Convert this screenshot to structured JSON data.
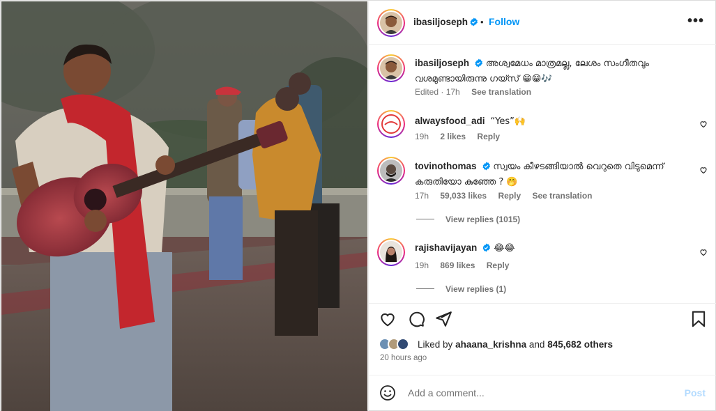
{
  "post": {
    "author": "ibasiljoseph",
    "follow_label": "Follow",
    "more_label": "•••",
    "separator": "•"
  },
  "caption": {
    "username": "ibasiljoseph",
    "text": "അശ്വമേധം മാത്രമല്ല, ലേശം സംഗീതവും വശമുണ്ടായിരുന്നു ഗയ്സ് 😁😁🎶",
    "edited": "Edited · 17h",
    "see_translation": "See translation"
  },
  "comments": [
    {
      "username": "alwaysfood_adi",
      "text": "“Yes”🙌",
      "time": "19h",
      "likes": "2 likes",
      "reply": "Reply"
    },
    {
      "username": "tovinothomas",
      "text": "സ്വയം കീഴടങ്ങിയാൽ വെറുതെ വിടുമെന്ന് കരുതിയോ കുഞ്ഞേ ? 🤭",
      "time": "17h",
      "likes": "59,033 likes",
      "reply": "Reply",
      "see_translation": "See translation",
      "view_replies": "View replies (1015)"
    },
    {
      "username": "rajishavijayan",
      "text": "😂😂",
      "time": "19h",
      "likes": "869 likes",
      "reply": "Reply",
      "view_replies": "View replies (1)"
    }
  ],
  "likes": {
    "prefix": "Liked by",
    "user": "ahaana_krishna",
    "middle": "and",
    "count": "845,682 others"
  },
  "timestamp": "20 hours ago",
  "composer": {
    "placeholder": "Add a comment...",
    "post_label": "Post"
  },
  "colors": {
    "link_blue": "#0095f6",
    "verified_blue": "#0095f6",
    "muted": "#737373",
    "post_disabled": "#b3dbff"
  },
  "icons": [
    "heart-icon",
    "comment-icon",
    "share-icon",
    "bookmark-icon",
    "emoji-icon",
    "verified-icon",
    "more-icon"
  ]
}
